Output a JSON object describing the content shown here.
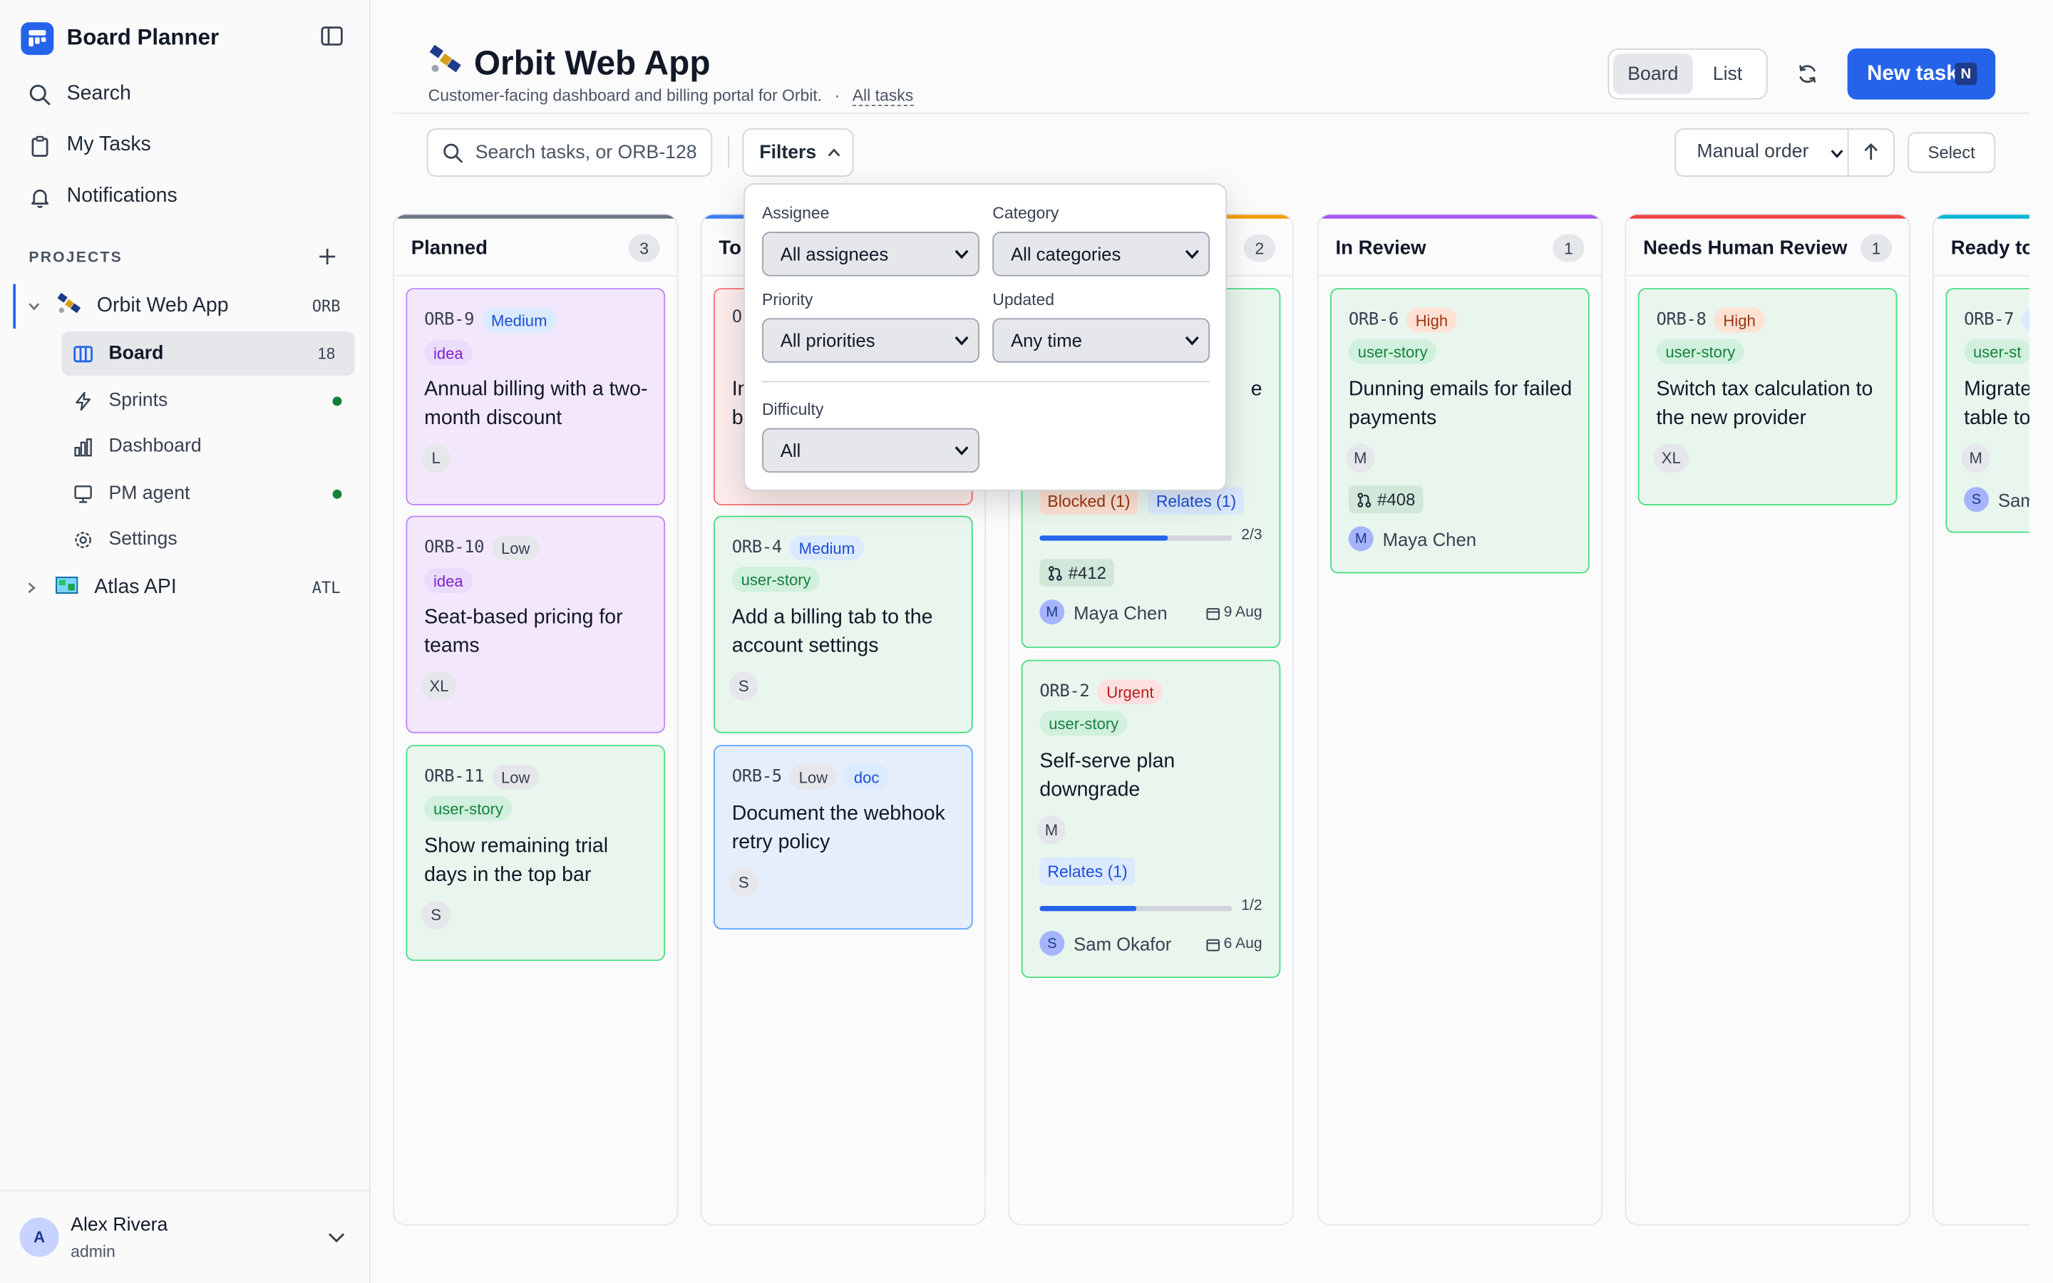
{
  "app": {
    "title": "Board Planner"
  },
  "nav": {
    "search": "Search",
    "my_tasks": "My Tasks",
    "notifications": "Notifications"
  },
  "projects": {
    "label": "PROJECTS",
    "items": [
      {
        "name": "Orbit Web App",
        "code": "ORB"
      },
      {
        "name": "Atlas API",
        "code": "ATL"
      }
    ],
    "sub": [
      {
        "label": "Board",
        "count": "18"
      },
      {
        "label": "Sprints"
      },
      {
        "label": "Dashboard"
      },
      {
        "label": "PM agent"
      },
      {
        "label": "Settings"
      }
    ]
  },
  "user": {
    "name": "Alex Rivera",
    "role": "admin",
    "initial": "A"
  },
  "header": {
    "title": "Orbit Web App",
    "subtitle": "Customer-facing dashboard and billing portal for Orbit.",
    "separator": "·",
    "all_tasks": "All tasks",
    "view_board": "Board",
    "view_list": "List",
    "new_task": "New task",
    "new_task_kbd": "N"
  },
  "toolbar": {
    "search_placeholder": "Search tasks, or ORB-128",
    "filters": "Filters",
    "order": "Manual order",
    "select": "Select"
  },
  "filters": {
    "assignee_label": "Assignee",
    "assignee_value": "All assignees",
    "category_label": "Category",
    "category_value": "All categories",
    "priority_label": "Priority",
    "priority_value": "All priorities",
    "updated_label": "Updated",
    "updated_value": "Any time",
    "difficulty_label": "Difficulty",
    "difficulty_value": "All"
  },
  "columns": [
    {
      "title": "Planned",
      "count": "3",
      "color": "#6b7280"
    },
    {
      "title": "To",
      "count": "",
      "color": "#3b82f6"
    },
    {
      "title": "",
      "count": "2",
      "color": "#f59e0b"
    },
    {
      "title": "In Review",
      "count": "1",
      "color": "#a855f7"
    },
    {
      "title": "Needs Human Review",
      "count": "1",
      "color": "#ef4444"
    },
    {
      "title": "Ready to",
      "count": "",
      "color": "#06b6d4"
    }
  ],
  "cards": {
    "orb9": {
      "id": "ORB-9",
      "priority": "Medium",
      "category": "idea",
      "title": "Annual billing with a two-month discount",
      "size": "L"
    },
    "orb10": {
      "id": "ORB-10",
      "priority": "Low",
      "category": "idea",
      "title": "Seat-based pricing for teams",
      "size": "XL"
    },
    "orb11": {
      "id": "ORB-11",
      "priority": "Low",
      "category": "user-story",
      "title": "Show remaining trial days in the top bar",
      "size": "S"
    },
    "partial_red": {
      "id": "O",
      "title_line1": "In",
      "title_line2": "b"
    },
    "orb4": {
      "id": "ORB-4",
      "priority": "Medium",
      "category": "user-story",
      "title": "Add a billing tab to the account settings",
      "size": "S"
    },
    "orb5": {
      "id": "ORB-5",
      "priority": "Low",
      "category": "doc",
      "title": "Document the webhook retry policy",
      "size": "S"
    },
    "partial_green": {
      "title_frag": "e",
      "blocked": "Blocked (1)",
      "relates": "Relates (1)",
      "progress_label": "2/3",
      "pr": "#412",
      "assignee": "Maya Chen",
      "assignee_initial": "M",
      "due": "9 Aug"
    },
    "orb2": {
      "id": "ORB-2",
      "priority": "Urgent",
      "category": "user-story",
      "title": "Self-serve plan downgrade",
      "size": "M",
      "relates": "Relates (1)",
      "progress_label": "1/2",
      "assignee": "Sam Okafor",
      "assignee_initial": "S",
      "due": "6 Aug"
    },
    "orb6": {
      "id": "ORB-6",
      "priority": "High",
      "category": "user-story",
      "title": "Dunning emails for failed payments",
      "size": "M",
      "pr": "#408",
      "assignee": "Maya Chen",
      "assignee_initial": "M"
    },
    "orb8": {
      "id": "ORB-8",
      "priority": "High",
      "category": "user-story",
      "title": "Switch tax calculation to the new provider",
      "size": "XL"
    },
    "orb7": {
      "id": "ORB-7",
      "category": "user-st",
      "title_line1": "Migrate",
      "title_line2": "table to",
      "size": "M",
      "assignee": "Sam",
      "assignee_initial": "S"
    }
  },
  "progress": {
    "partial_green": 0.667,
    "orb2": 0.5
  }
}
